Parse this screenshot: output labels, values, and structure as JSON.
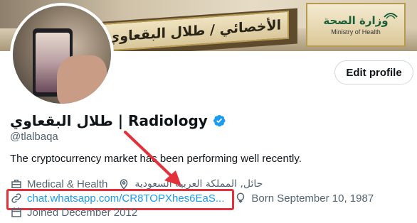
{
  "banner": {
    "nameplate_text": "الأخصائي / طلال البقعاوي",
    "ministry_ar": "وزارة الصحة",
    "ministry_en": "Ministry of Health"
  },
  "header": {
    "edit_profile_label": "Edit profile"
  },
  "profile": {
    "display_name": "طلال البقعاوي | Radiology",
    "handle": "@tlalbaqa",
    "bio": "The cryptocurrency market has been performing well recently.",
    "category": "Medical & Health",
    "location": "حائل, المملكة العربية السعودية",
    "link": "chat.whatsapp.com/CR8TOPXhes6EaS...",
    "birthday": "Born September 10, 1987",
    "joined": "Joined December 2012"
  },
  "colors": {
    "link": "#1d9bf0",
    "verified": "#1d9bf0",
    "annotation": "#e3303a",
    "secondary_text": "#536471"
  },
  "icons": [
    "briefcase-icon",
    "location-pin-icon",
    "link-icon",
    "balloon-icon",
    "calendar-icon",
    "verified-badge-icon"
  ]
}
